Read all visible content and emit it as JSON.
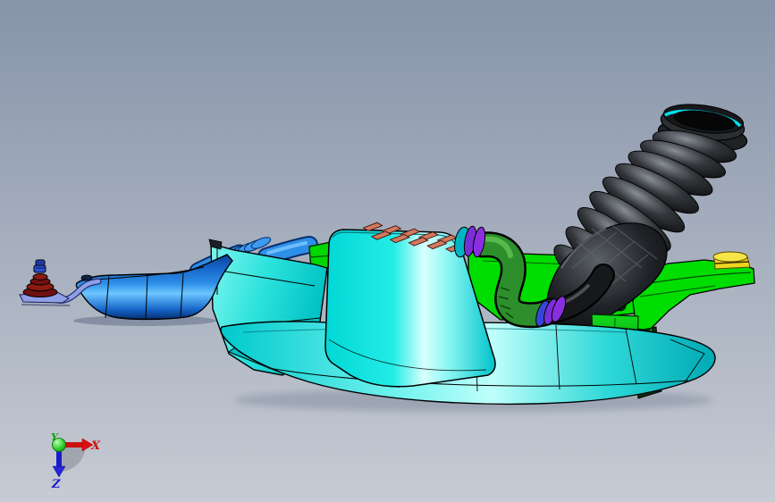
{
  "viewport": {
    "background_top": "#8794a9",
    "background_bottom": "#c6cbd4"
  },
  "triad": {
    "x_label": "X",
    "y_label": "Y",
    "z_label": "Z",
    "x_color": "#cc1111",
    "y_color": "#00a300",
    "z_color": "#1a1acc",
    "origin_color": "#19d419"
  },
  "colors": {
    "duct_blue": "#2e8fe8",
    "duct_blue_dark": "#0a3f92",
    "tube_periwinkle": "#8fa0e8",
    "mount_red": "#8a1a12",
    "mount_red_dark": "#6b0f0c",
    "knob_blue": "#2a4fd0",
    "housing_cyan": "#00e2e0",
    "housing_cyan_dark": "#00bfc6",
    "grille_salmon": "#d0795f",
    "connector_green": "#00d800",
    "tray_green": "#00dd00",
    "hose_green": "#2c8f2c",
    "clamp_purple": "#7a2fd6",
    "clamp_blue": "#3548d8",
    "stub_teal": "#00b4c4",
    "intake_hose_black": "#1b1d20",
    "hose_rim_cyan": "#00dff2",
    "grommet_yellow": "#efd51c"
  },
  "parts": [
    {
      "name": "resonator-mount",
      "color": "#8a1a12"
    },
    {
      "name": "mount-plate",
      "color": "#8fa0e8"
    },
    {
      "name": "intake-duct",
      "color": "#2e8fe8"
    },
    {
      "name": "duct-snorkel",
      "color": "#2e8fe8"
    },
    {
      "name": "connector-fitting",
      "color": "#00d800"
    },
    {
      "name": "air-cleaner-side-panel",
      "color": "#2ce2dc"
    },
    {
      "name": "air-cleaner-upper-cover",
      "color": "#00e2e0"
    },
    {
      "name": "air-cleaner-lower-housing",
      "color": "#00bfc6"
    },
    {
      "name": "inlet-grille",
      "color": "#d0795f"
    },
    {
      "name": "mounting-tray",
      "color": "#00dd00"
    },
    {
      "name": "bracket-arm",
      "color": "#00dd00"
    },
    {
      "name": "grommet",
      "color": "#efd51c"
    },
    {
      "name": "breather-elbow-hose",
      "color": "#2c8f2c"
    },
    {
      "name": "hose-clamps",
      "color": "#7a2fd6"
    },
    {
      "name": "corrugated-intake-hose",
      "color": "#1b1d20"
    },
    {
      "name": "hose-end-seal",
      "color": "#00dff2"
    }
  ]
}
